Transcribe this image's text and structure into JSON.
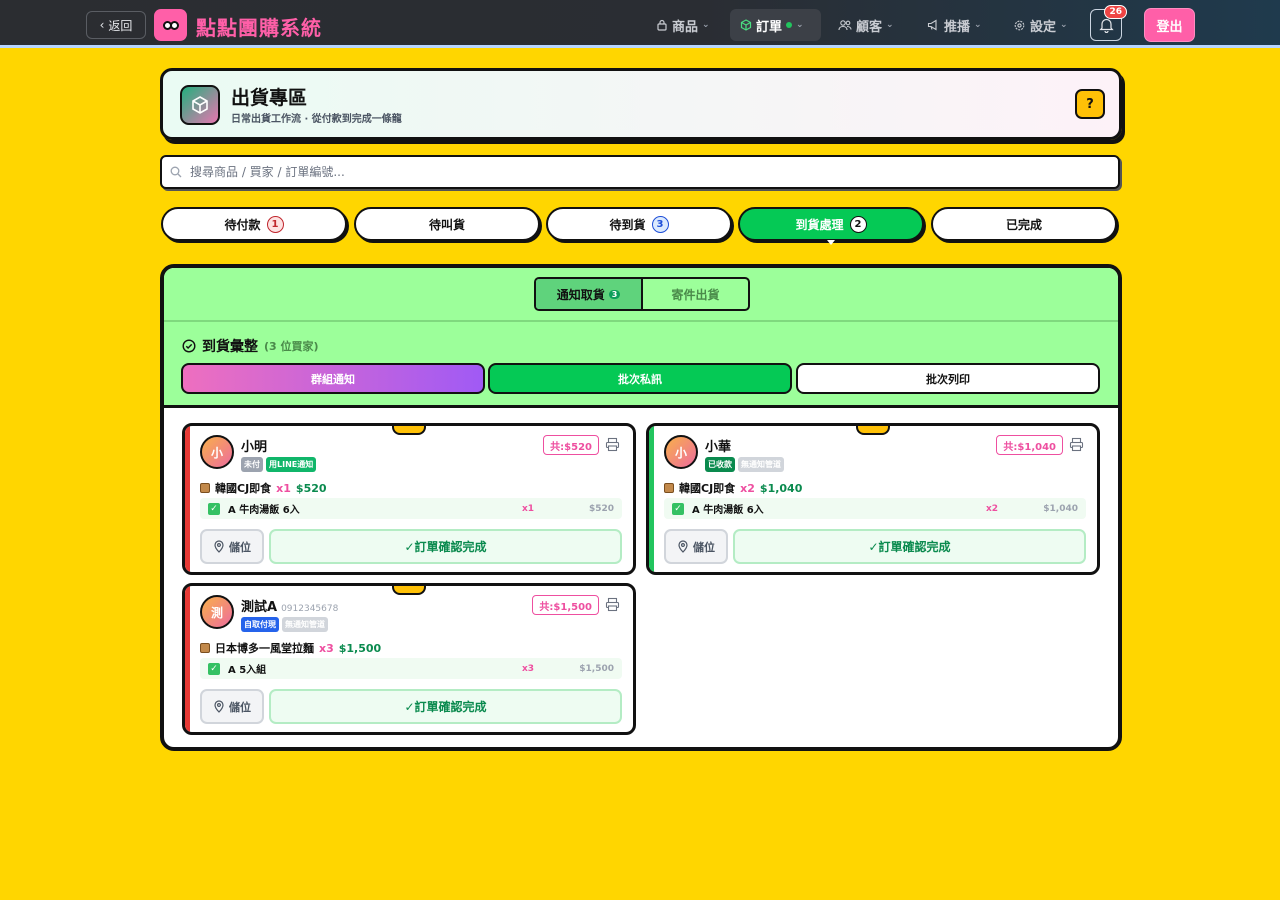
{
  "topbar": {
    "back_label": "返回",
    "app_title": "點點團購系統",
    "nav": [
      {
        "label": "商品",
        "icon": "lock-icon",
        "active": false
      },
      {
        "label": "訂單",
        "icon": "box-icon",
        "active": true
      },
      {
        "label": "顧客",
        "icon": "users-icon",
        "active": false
      },
      {
        "label": "推播",
        "icon": "megaphone-icon",
        "active": false
      },
      {
        "label": "設定",
        "icon": "gear-icon",
        "active": false
      }
    ],
    "notification_count": "26",
    "logout_label": "登出"
  },
  "header": {
    "title": "出貨專區",
    "subtitle": "日常出貨工作流 · 從付款到完成一條龍",
    "help_label": "?"
  },
  "search": {
    "placeholder": "搜尋商品 / 買家 / 訂單編號..."
  },
  "tabs": [
    {
      "label": "待付款",
      "count": "1",
      "active": false
    },
    {
      "label": "待叫貨",
      "count": "",
      "active": false
    },
    {
      "label": "待到貨",
      "count": "3",
      "active": false
    },
    {
      "label": "到貨處理",
      "count": "2",
      "active": true
    },
    {
      "label": "已完成",
      "count": "",
      "active": false
    }
  ],
  "subtabs": [
    {
      "label": "通知取貨",
      "count": "3",
      "active": true
    },
    {
      "label": "寄件出貨",
      "count": "",
      "active": false
    }
  ],
  "summary": {
    "title": "到貨彙整",
    "sub": "(3 位買家)",
    "actions": [
      "群組通知",
      "批次私訊",
      "批次列印"
    ]
  },
  "cards": [
    {
      "avatar": "小",
      "name": "小明",
      "phone": "",
      "badges": [
        {
          "text": "未付",
          "color": "gray"
        },
        {
          "text": "用LINE通知",
          "color": "green"
        }
      ],
      "total": "共:$520",
      "product": "韓國CJ即食",
      "product_qty": "x1",
      "product_price": "$520",
      "item": {
        "name": "A 牛肉湯飯 6入",
        "qty": "x1",
        "price": "$520"
      },
      "storage_label": "儲位",
      "confirm_label": "✓訂單確認完成",
      "stripe": "#e53935"
    },
    {
      "avatar": "小",
      "name": "小華",
      "phone": "",
      "badges": [
        {
          "text": "已收款",
          "color": "dgreen"
        },
        {
          "text": "無通知管道",
          "color": "lgray"
        }
      ],
      "total": "共:$1,040",
      "product": "韓國CJ即食",
      "product_qty": "x2",
      "product_price": "$1,040",
      "item": {
        "name": "A 牛肉湯飯 6入",
        "qty": "x2",
        "price": "$1,040"
      },
      "storage_label": "儲位",
      "confirm_label": "✓訂單確認完成",
      "stripe": "#22c55e"
    },
    {
      "avatar": "測",
      "name": "測試A",
      "phone": "0912345678",
      "badges": [
        {
          "text": "自取付現",
          "color": "blue"
        },
        {
          "text": "無通知管道",
          "color": "lgray"
        }
      ],
      "total": "共:$1,500",
      "product": "日本博多一風堂拉麵",
      "product_qty": "x3",
      "product_price": "$1,500",
      "item": {
        "name": "A 5入組",
        "qty": "x3",
        "price": "$1,500"
      },
      "storage_label": "儲位",
      "confirm_label": "✓訂單確認完成",
      "stripe": "#e53935"
    }
  ]
}
